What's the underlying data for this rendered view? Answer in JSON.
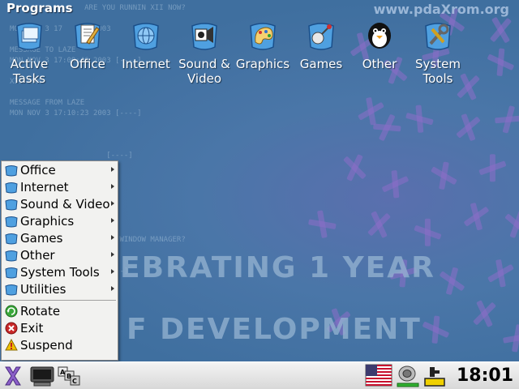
{
  "desktop": {
    "title": "Programs",
    "watermark": "www.pdaXrom.org",
    "banner_line1": "EBRATING 1 YEAR",
    "banner_line2": "F DEVELOPMENT",
    "console_lines": [
      "                 ARE YOU RUNNIN XII NOW?",
      "                 ",
      "MON NOV 3 17       2003",
      "",
      "MESSAGE TO LAZE",
      "MON NOV 3 17:09:46 2003 [----]",
      "",
      "XII ROM",
      "",
      "MESSAGE FROM LAZE",
      "MON NOV 3 17:10:23 2003 [----]",
      "",
      "",
      "",
      "                      [----]",
      "",
      "",
      "",
      "",
      "",
      "",
      "",
      "                      AS WINDOW MANAGER?",
      "",
      "",
      "                     [----]"
    ]
  },
  "launchers": [
    {
      "label": "Active Tasks",
      "icon": "active-tasks-icon",
      "name": "launcher-active-tasks"
    },
    {
      "label": "Office",
      "icon": "office-icon",
      "name": "launcher-office"
    },
    {
      "label": "Internet",
      "icon": "internet-icon",
      "name": "launcher-internet"
    },
    {
      "label": "Sound & Video",
      "icon": "sound-video-icon",
      "name": "launcher-sound-video"
    },
    {
      "label": "Graphics",
      "icon": "graphics-icon",
      "name": "launcher-graphics"
    },
    {
      "label": "Games",
      "icon": "games-icon",
      "name": "launcher-games"
    },
    {
      "label": "Other",
      "icon": "other-icon",
      "name": "launcher-other"
    },
    {
      "label": "System Tools",
      "icon": "system-tools-icon",
      "name": "launcher-system-tools"
    }
  ],
  "menu": {
    "submenus": [
      {
        "label": "Office"
      },
      {
        "label": "Internet"
      },
      {
        "label": "Sound & Video"
      },
      {
        "label": "Graphics"
      },
      {
        "label": "Games"
      },
      {
        "label": "Other"
      },
      {
        "label": "System Tools"
      },
      {
        "label": "Utilities"
      }
    ],
    "actions": [
      {
        "label": "Rotate",
        "icon": "rotate-icon",
        "color": "#3aa83a"
      },
      {
        "label": "Exit",
        "icon": "exit-icon",
        "color": "#c82828"
      },
      {
        "label": "Suspend",
        "icon": "suspend-icon",
        "color": "#e0a800"
      }
    ]
  },
  "taskbar": {
    "clock": "18:01",
    "colors": {
      "accent_purple": "#8b5fc8",
      "battery_fill": "#f0d000",
      "flag_red": "#c8102e",
      "flag_blue": "#3c3b6e"
    }
  }
}
